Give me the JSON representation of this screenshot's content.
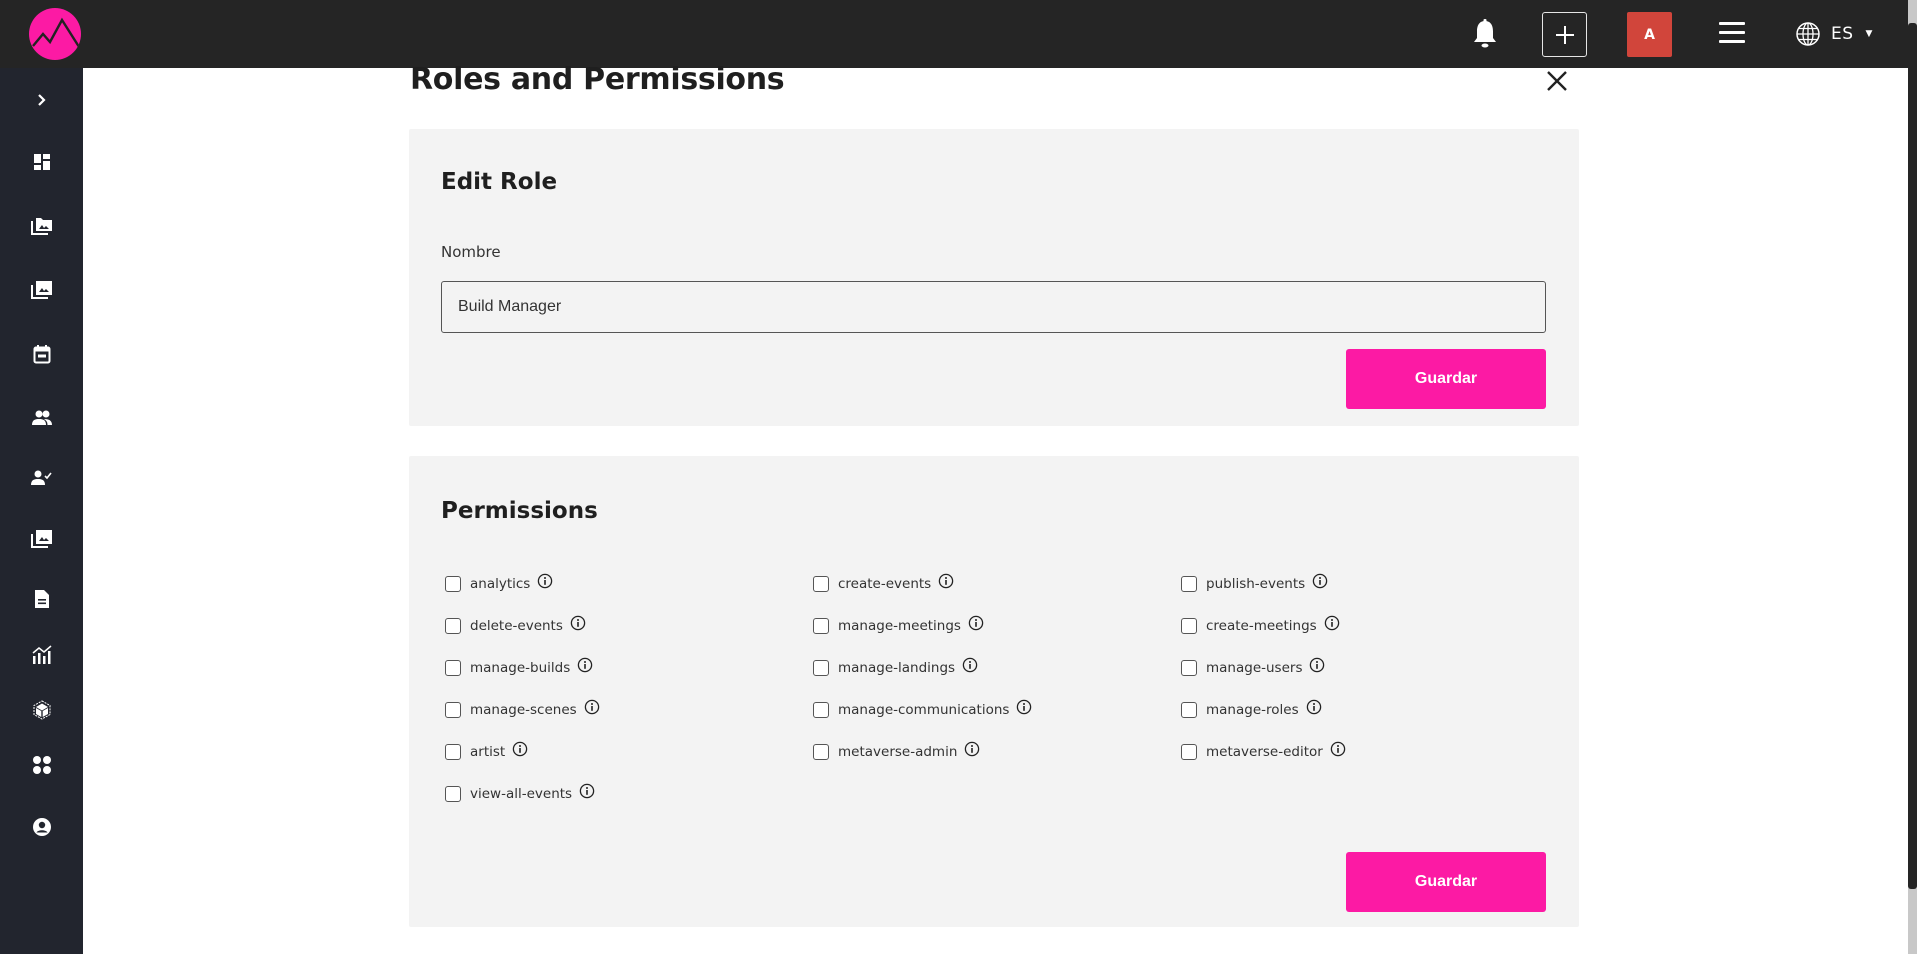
{
  "header": {
    "logo": "brand-logo",
    "icons": {
      "notifications": "bell-icon",
      "create": "plus-icon",
      "menu": "hamburger-menu-icon",
      "language": "globe-icon"
    },
    "avatar_initial": "A",
    "language_code": "ES",
    "colors": {
      "bar": "#252525",
      "brand": "#fc1aa4",
      "avatar": "#d1453b"
    }
  },
  "sidebar": {
    "items": [
      {
        "name": "expand",
        "icon": "chevron-right-icon"
      },
      {
        "name": "dashboard",
        "icon": "dashboard-icon"
      },
      {
        "name": "media-folders",
        "icon": "photo-folder-icon"
      },
      {
        "name": "galleries",
        "icon": "photo-library-icon"
      },
      {
        "name": "events",
        "icon": "calendar-icon"
      },
      {
        "name": "users",
        "icon": "people-icon"
      },
      {
        "name": "user-roles",
        "icon": "user-check-icon"
      },
      {
        "name": "media-library",
        "icon": "photo-library-icon"
      },
      {
        "name": "documents",
        "icon": "document-icon"
      },
      {
        "name": "analytics",
        "icon": "analytics-icon"
      },
      {
        "name": "3d-objects",
        "icon": "cube-icon"
      },
      {
        "name": "apps",
        "icon": "apps-dots-icon"
      },
      {
        "name": "account",
        "icon": "account-circle-icon"
      }
    ]
  },
  "page": {
    "title": "Roles and Permissions",
    "close_icon": "close-icon"
  },
  "edit_role": {
    "title": "Edit Role",
    "name_label": "Nombre",
    "name_value": "Build Manager",
    "save_label": "Guardar"
  },
  "permissions": {
    "title": "Permissions",
    "save_label": "Guardar",
    "items": [
      {
        "label": "analytics",
        "checked": false
      },
      {
        "label": "create-events",
        "checked": false
      },
      {
        "label": "publish-events",
        "checked": false
      },
      {
        "label": "delete-events",
        "checked": false
      },
      {
        "label": "manage-meetings",
        "checked": false
      },
      {
        "label": "create-meetings",
        "checked": false
      },
      {
        "label": "manage-builds",
        "checked": false
      },
      {
        "label": "manage-landings",
        "checked": false
      },
      {
        "label": "manage-users",
        "checked": false
      },
      {
        "label": "manage-scenes",
        "checked": false
      },
      {
        "label": "manage-communications",
        "checked": false
      },
      {
        "label": "manage-roles",
        "checked": false
      },
      {
        "label": "artist",
        "checked": false
      },
      {
        "label": "metaverse-admin",
        "checked": false
      },
      {
        "label": "metaverse-editor",
        "checked": false
      },
      {
        "label": "view-all-events",
        "checked": false
      }
    ]
  }
}
